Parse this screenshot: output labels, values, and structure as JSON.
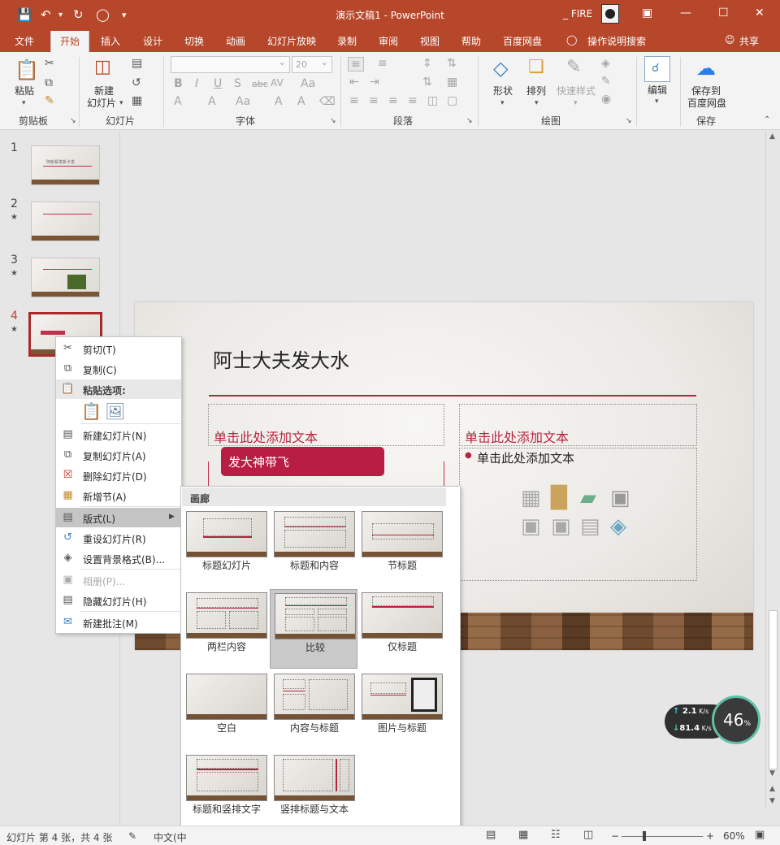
{
  "app": {
    "doc_title": "演示文稿1 - PowerPoint",
    "user": "_ FIRE"
  },
  "tabs": [
    "文件",
    "开始",
    "插入",
    "设计",
    "切换",
    "动画",
    "幻灯片放映",
    "录制",
    "审阅",
    "视图",
    "帮助",
    "百度网盘",
    "操作说明搜索"
  ],
  "share_label": "共享",
  "ribbon": {
    "paste": "粘贴",
    "new_slide_1": "新建",
    "new_slide_2": "幻灯片",
    "shape": "形状",
    "arrange": "排列",
    "quick_style": "快速样式",
    "edit": "编辑",
    "save_baidu_1": "保存到",
    "save_baidu_2": "百度网盘",
    "font_size": "20",
    "groups": {
      "clipboard": "剪贴板",
      "slides": "幻灯片",
      "font": "字体",
      "paragraph": "段落",
      "drawing": "绘图",
      "save": "保存"
    }
  },
  "thumbs": [
    {
      "num": "1",
      "title": "阿斯顿发斯卡发"
    },
    {
      "num": "2"
    },
    {
      "num": "3"
    },
    {
      "num": "4"
    }
  ],
  "slide": {
    "title": "阿士大夫发大水",
    "left_header": "单击此处添加文本",
    "right_header": "单击此处添加文本",
    "right_bullet": "单击此处添加文本",
    "red_box": "发大神带飞"
  },
  "context_menu": {
    "cut": "剪切(T)",
    "copy": "复制(C)",
    "paste_options": "粘贴选项:",
    "new_slide": "新建幻灯片(N)",
    "dup_slide": "复制幻灯片(A)",
    "del_slide": "删除幻灯片(D)",
    "new_section": "新增节(A)",
    "layout": "版式(L)",
    "reset_slide": "重设幻灯片(R)",
    "bg_format": "设置背景格式(B)...",
    "album": "相册(P)...",
    "hide_slide": "隐藏幻灯片(H)",
    "new_comment": "新建批注(M)"
  },
  "gallery": {
    "header": "画廊",
    "items": [
      "标题幻灯片",
      "标题和内容",
      "节标题",
      "两栏内容",
      "比较",
      "仅标题",
      "空白",
      "内容与标题",
      "图片与标题",
      "标题和竖排文字",
      "竖排标题与文本"
    ],
    "selected": "比较"
  },
  "status": {
    "slide_info": "幻灯片 第 4 张，共 4 张",
    "lang": "中文(中",
    "zoom": "60%"
  },
  "speed": {
    "up": "2.1",
    "down": "81.4",
    "unit": "K/s",
    "percent": "46"
  },
  "colors": {
    "accent": "#b7472a",
    "slide_accent": "#b8253f"
  }
}
